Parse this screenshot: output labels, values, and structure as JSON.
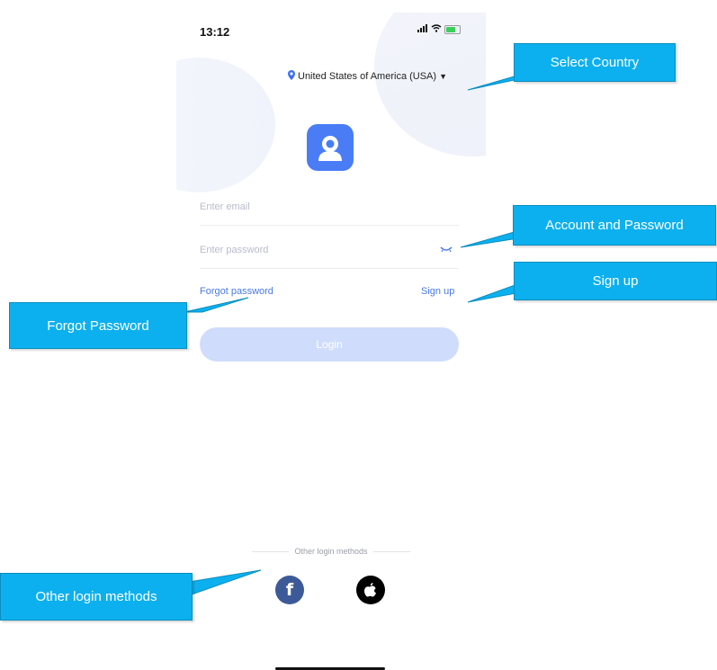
{
  "status_bar": {
    "time": "13:12"
  },
  "country_selector": {
    "label": "United States of America (USA)"
  },
  "login_form": {
    "email_placeholder": "Enter email",
    "password_placeholder": "Enter password",
    "forgot_password": "Forgot password",
    "sign_up": "Sign up",
    "login_button": "Login"
  },
  "other_login": {
    "label": "Other login methods",
    "methods": [
      {
        "name": "Facebook",
        "icon": "facebook-icon"
      },
      {
        "name": "Apple",
        "icon": "apple-icon"
      }
    ]
  },
  "callouts": {
    "select_country": "Select Country",
    "account_password": "Account and Password",
    "sign_up": "Sign up",
    "forgot_password": "Forgot Password",
    "other_login_methods": "Other login methods"
  },
  "colors": {
    "accent": "#4a7cf6",
    "callout": "#0db0ee",
    "login_disabled": "#cfdcfb",
    "facebook": "#3d5a98"
  }
}
